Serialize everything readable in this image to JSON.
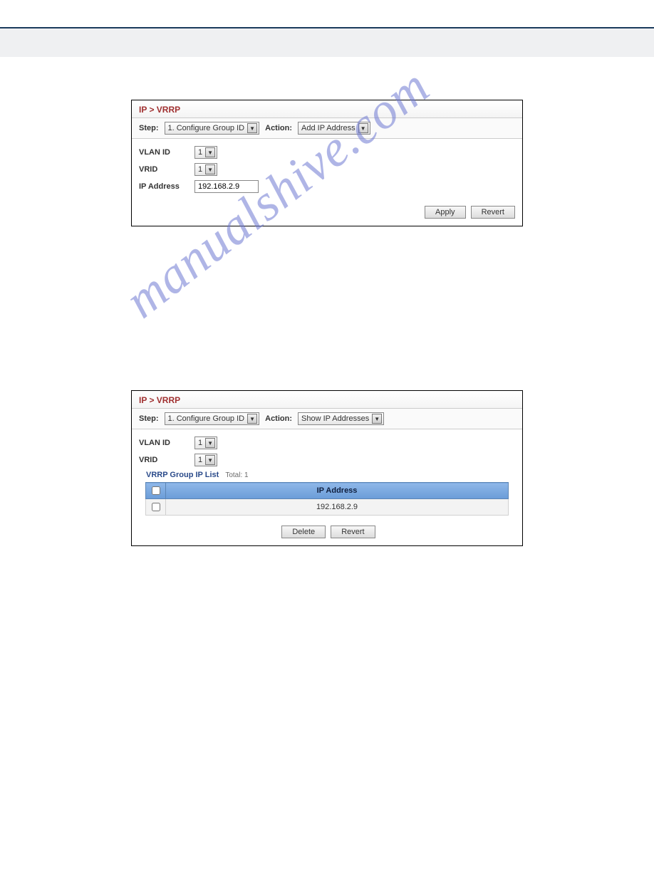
{
  "watermark": "manualshive.com",
  "panel1": {
    "title": "IP > VRRP",
    "step_label": "Step:",
    "step_value": "1. Configure Group ID",
    "action_label": "Action:",
    "action_value": "Add IP Address",
    "form": {
      "vlan_label": "VLAN ID",
      "vlan_value": "1",
      "vrid_label": "VRID",
      "vrid_value": "1",
      "ip_label": "IP Address",
      "ip_value": "192.168.2.9"
    },
    "buttons": {
      "apply": "Apply",
      "revert": "Revert"
    }
  },
  "panel2": {
    "title": "IP > VRRP",
    "step_label": "Step:",
    "step_value": "1. Configure Group ID",
    "action_label": "Action:",
    "action_value": "Show IP Addresses",
    "form": {
      "vlan_label": "VLAN ID",
      "vlan_value": "1",
      "vrid_label": "VRID",
      "vrid_value": "1"
    },
    "list": {
      "heading": "VRRP Group IP List",
      "total_label": "Total: 1",
      "column": "IP Address",
      "rows": [
        {
          "ip": "192.168.2.9"
        }
      ]
    },
    "buttons": {
      "delete": "Delete",
      "revert": "Revert"
    }
  }
}
